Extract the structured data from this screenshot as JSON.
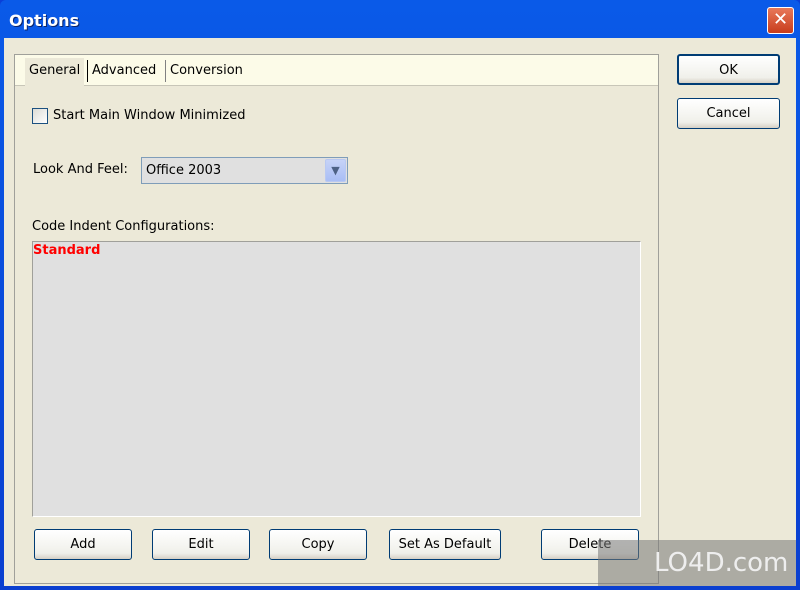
{
  "window": {
    "title": "Options",
    "close_glyph": "✕"
  },
  "tabs": [
    {
      "label": "General",
      "selected": true
    },
    {
      "label": "Advanced",
      "selected": false
    },
    {
      "label": "Conversion",
      "selected": false
    }
  ],
  "general": {
    "start_minimized_label": "Start Main Window Minimized",
    "start_minimized_checked": false,
    "look_feel_label": "Look And Feel:",
    "look_feel_value": "Office 2003",
    "code_indent_label": "Code Indent Configurations:",
    "configs": [
      "Standard"
    ],
    "config_color": "#ff0000",
    "buttons": {
      "add": "Add",
      "edit": "Edit",
      "copy": "Copy",
      "set_default": "Set As Default",
      "delete": "Delete"
    }
  },
  "dialog_buttons": {
    "ok": "OK",
    "cancel": "Cancel"
  },
  "watermark": "LO4D.com"
}
